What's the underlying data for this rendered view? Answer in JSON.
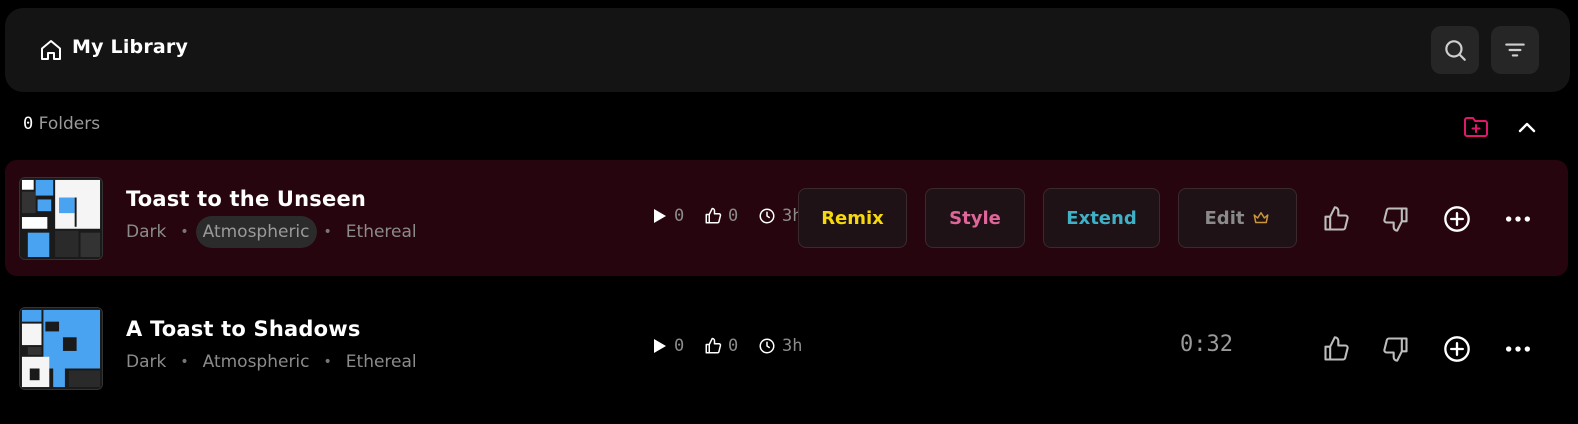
{
  "header": {
    "title": "My Library",
    "search_icon": "search-icon",
    "filter_icon": "filter-icon",
    "home_icon": "home-icon"
  },
  "folders": {
    "count": "0",
    "label": "Folders"
  },
  "accent": "#e0186c",
  "tracks": [
    {
      "title": "Toast to the Unseen",
      "tags": [
        "Dark",
        "Atmospheric",
        "Ethereal"
      ],
      "plays": "0",
      "likes": "0",
      "age": "3h",
      "actions": {
        "remix": "Remix",
        "style": "Style",
        "extend": "Extend",
        "edit": "Edit"
      },
      "action_colors": {
        "remix": "#f5d90a",
        "style": "#e0669a",
        "extend": "#3fb0c6",
        "edit": "#8a8a8a"
      }
    },
    {
      "title": "A Toast to Shadows",
      "tags": [
        "Dark",
        "Atmospheric",
        "Ethereal"
      ],
      "plays": "0",
      "likes": "0",
      "age": "3h",
      "duration": "0:32"
    }
  ]
}
